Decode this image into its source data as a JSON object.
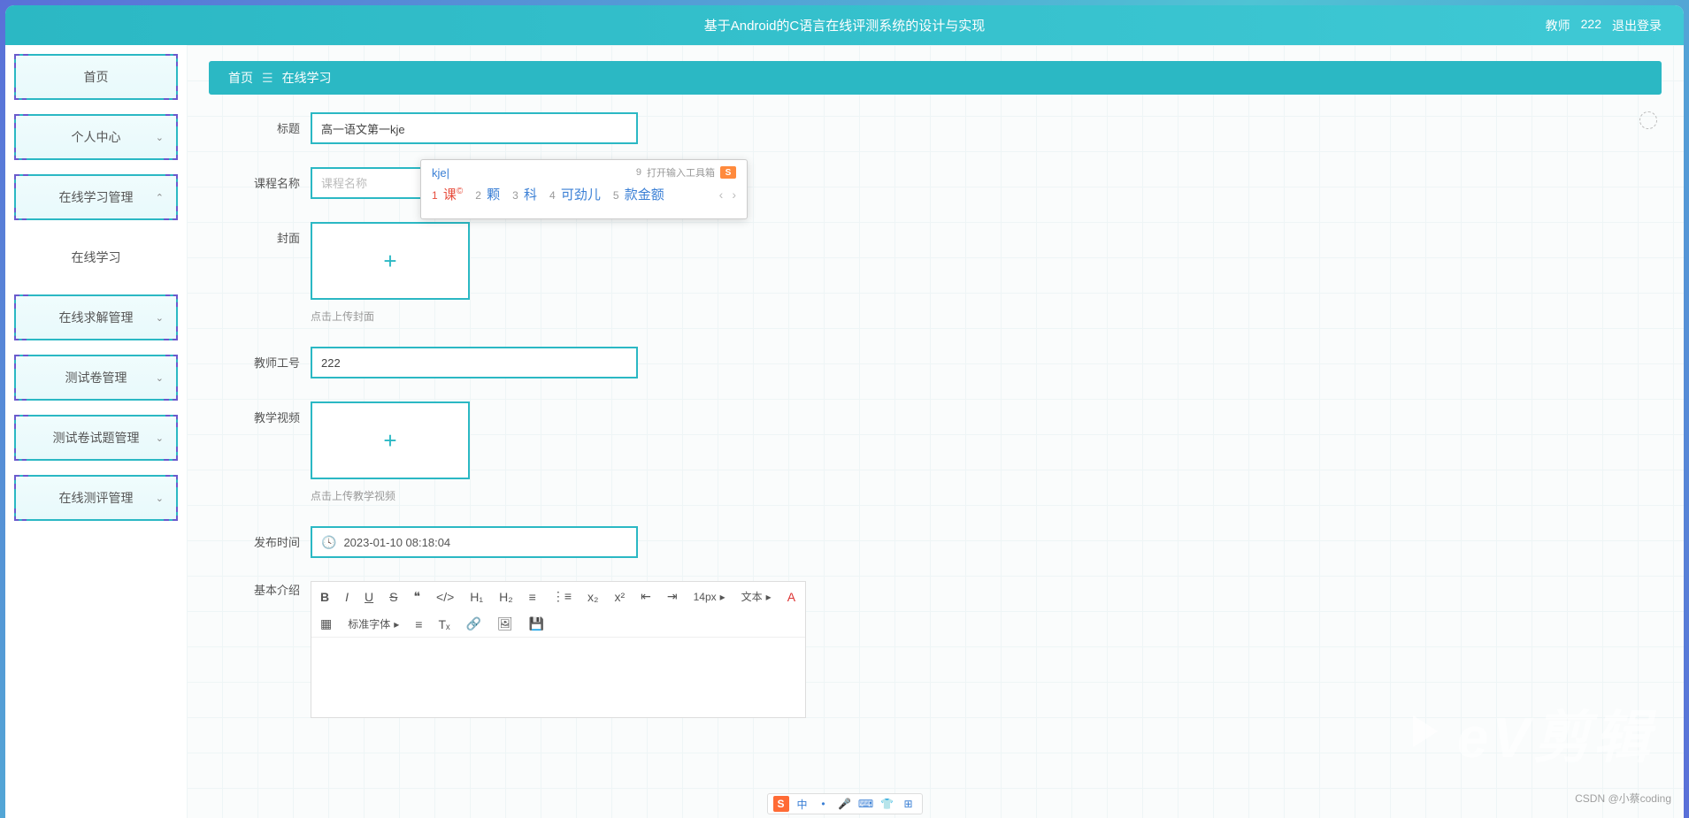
{
  "header": {
    "title": "基于Android的C语言在线评测系统的设计与实现",
    "user_prefix": "教师",
    "user_id": "222",
    "logout": "退出登录"
  },
  "breadcrumb": {
    "home": "首页",
    "current": "在线学习"
  },
  "sidebar": {
    "items": [
      {
        "label": "首页",
        "expandable": false
      },
      {
        "label": "个人中心",
        "expandable": true
      },
      {
        "label": "在线学习管理",
        "expandable": true
      },
      {
        "label": "在线学习",
        "expandable": false,
        "active": true
      },
      {
        "label": "在线求解管理",
        "expandable": true
      },
      {
        "label": "测试卷管理",
        "expandable": true
      },
      {
        "label": "测试卷试题管理",
        "expandable": true
      },
      {
        "label": "在线测评管理",
        "expandable": true
      }
    ]
  },
  "form": {
    "title": {
      "label": "标题",
      "value": "高一语文第一kje"
    },
    "course": {
      "label": "课程名称",
      "placeholder": "课程名称",
      "value": ""
    },
    "cover": {
      "label": "封面",
      "hint": "点击上传封面"
    },
    "teacher": {
      "label": "教师工号",
      "value": "222"
    },
    "video": {
      "label": "教学视频",
      "hint": "点击上传教学视频"
    },
    "publish": {
      "label": "发布时间",
      "value": "2023-01-10 08:18:04"
    },
    "intro": {
      "label": "基本介绍"
    }
  },
  "editor": {
    "font_size": "14px",
    "format": "文本",
    "font_family": "标准字体",
    "buttons": {
      "bold": "B",
      "italic": "I",
      "underline": "U",
      "strike": "S",
      "quote": "❝",
      "code": "</>",
      "h1": "H₁",
      "h2": "H₂",
      "ol": "≡",
      "ul": "⋮≡",
      "sub": "x₂",
      "sup": "x²",
      "indent": "⇤",
      "outdent": "⇥",
      "color": "A",
      "bg": "▦",
      "align": "≡",
      "clear": "Tₓ",
      "link": "🔗",
      "image": "🖼",
      "save": "💾"
    }
  },
  "ime": {
    "typed": "kje",
    "toolbox_hint": "打开输入工具箱",
    "toolbox_num": "9",
    "candidates": [
      {
        "n": "1",
        "text": "课",
        "badge": "©"
      },
      {
        "n": "2",
        "text": "颗"
      },
      {
        "n": "3",
        "text": "科"
      },
      {
        "n": "4",
        "text": "可劲儿"
      },
      {
        "n": "5",
        "text": "款金额"
      }
    ]
  },
  "watermark": {
    "logo": "eV剪辑",
    "text": "CSDN @小蔡coding"
  },
  "taskbar": {
    "items": [
      "S",
      "中",
      "•",
      "🎤",
      "⌨",
      "👕",
      "⊞"
    ]
  }
}
